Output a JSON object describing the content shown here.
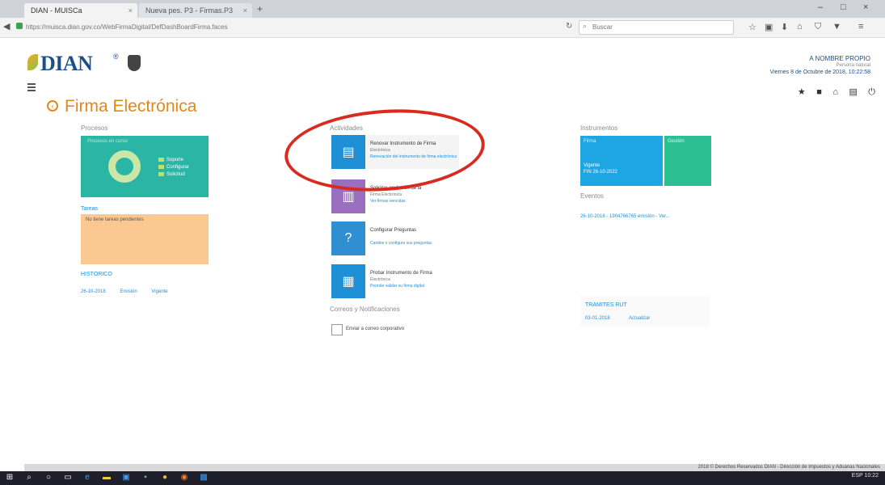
{
  "browser": {
    "tabs": [
      {
        "label": "DIAN - MUISCa",
        "close": "×"
      },
      {
        "label": "Nueva pes. P3 - Firmas.P3",
        "close": "×"
      }
    ],
    "new_tab": "+",
    "window_controls": {
      "minimize": "–",
      "maximize": "□",
      "close": "×"
    },
    "address_prefix": "https://muisca.dian.gov.co/WebFirmaDigital/DefDashBoardFirma.faces",
    "address_domain": "dian.gov.co",
    "search_placeholder": "Buscar"
  },
  "header": {
    "logo_text": "DIAN",
    "logo_reg": "®",
    "user_name": "A NOMBRE PROPIO",
    "user_role": "Persona natural",
    "user_date": "Viernes 8 de Octubre de 2018, 10:22:58"
  },
  "page": {
    "title": "Firma Electrónica"
  },
  "left": {
    "procesos_label": "Procesos",
    "process_header": "Procesos en curso",
    "legend": [
      "Soporte",
      "Configurar",
      "Solicitud"
    ],
    "tareas_label": "Tareas",
    "tareas_text": "No tiene tareas pendientes",
    "historico_label": "HISTORICO",
    "historico_row": [
      "26-10-2018",
      "Emisión",
      "Vigente"
    ]
  },
  "center": {
    "actividades_label": "Actividades",
    "activities": [
      {
        "title": "Renovar Instrumento de Firma",
        "sub": "Electrónica",
        "link": "Renovación del instrumento de firma electrónica",
        "color": "#1f8fd6"
      },
      {
        "title": "Solicitar anulación de la",
        "sub": "Firma Electrónica",
        "link": "Ver firmas vencidas",
        "color": "#9a6fc0"
      },
      {
        "title": "Configurar Preguntas",
        "sub": "",
        "link": "Cambie o configure sus preguntas",
        "color": "#2f8fd1"
      },
      {
        "title": "Probar Instrumento de Firma",
        "sub": "Electrónica",
        "link": "Permite validar su firma digital",
        "color": "#1f8fd6"
      }
    ],
    "correos_label": "Correos y Notificaciones",
    "checkbox_label": "Enviar a correo corporativo"
  },
  "right": {
    "instrumentos_label": "Instrumentos",
    "tile_blue": {
      "t1": "Firma",
      "t2": "Vigente",
      "t3": "FIN 26-10-2022"
    },
    "tile_green": {
      "t1": "Gestión",
      "t2": "",
      "t3": ""
    },
    "eventos_label": "Eventos",
    "eventos_row": "26-10-2018 - 1904766765 emisión - Ver...",
    "tramites_label": "TRAMITES RUT",
    "tramites_row": [
      "03-01-2018",
      "Actualizar"
    ]
  },
  "footer": {
    "text": "2018 © Derechos Reservados DIAN - Dirección de Impuestos y Aduanas Nacionales"
  },
  "taskbar": {
    "tray": "ESP 10:22"
  },
  "colors": {
    "accent_orange": "#e2871b",
    "brand_blue": "#1d4e89",
    "link_blue": "#1f8fd6",
    "teal": "#2ab5a5",
    "peach": "#fbc892",
    "annotation_red": "#d82a1e"
  }
}
